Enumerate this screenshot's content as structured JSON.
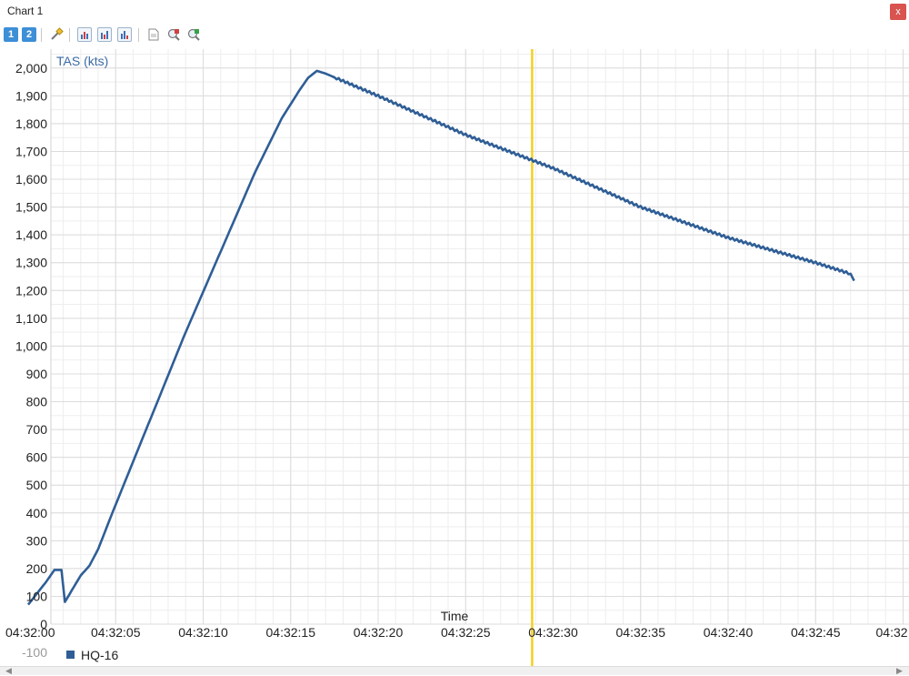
{
  "window": {
    "title": "Chart 1",
    "close_label": "x"
  },
  "toolbar": {
    "btn1_label": "1",
    "btn2_label": "2",
    "icons": [
      "marker-icon",
      "chart-type-a-icon",
      "chart-type-b-icon",
      "chart-type-c-icon",
      "page-icon",
      "zoom-in-icon",
      "zoom-out-icon"
    ]
  },
  "colors": {
    "series": "#2f5e96",
    "cursor": "#f5d020",
    "close": "#d9534f",
    "grid": "#e4e4e4"
  },
  "chart_data": {
    "type": "line",
    "ylabel": "TAS (kts)",
    "xlabel": "Time",
    "ylim": [
      -100,
      2050
    ],
    "xlim": [
      0,
      49
    ],
    "yticks": [
      -100,
      0,
      100,
      200,
      300,
      400,
      500,
      600,
      700,
      800,
      900,
      1000,
      1100,
      1200,
      1300,
      1400,
      1500,
      1600,
      1700,
      1800,
      1900,
      2000
    ],
    "ytick_labels": [
      "-100",
      "0",
      "100",
      "200",
      "300",
      "400",
      "500",
      "600",
      "700",
      "800",
      "900",
      "1,000",
      "1,100",
      "1,200",
      "1,300",
      "1,400",
      "1,500",
      "1,600",
      "1,700",
      "1,800",
      "1,900",
      "2,000"
    ],
    "xticks": [
      0,
      5,
      10,
      15,
      20,
      25,
      30,
      35,
      40,
      45,
      50
    ],
    "xtick_labels": [
      "04:32:00",
      "04:32:05",
      "04:32:10",
      "04:32:15",
      "04:32:20",
      "04:32:25",
      "04:32:30",
      "04:32:35",
      "04:32:40",
      "04:32:45",
      "04:32"
    ],
    "cursor_x": 28.8,
    "grid": true,
    "legend_position": "bottom-left",
    "series": [
      {
        "name": "HQ-16",
        "x": [
          0,
          0.5,
          1,
          1.5,
          1.9,
          2.1,
          3,
          3.5,
          4,
          5,
          7,
          9,
          11,
          13,
          14.5,
          15.5,
          16,
          16.5,
          17,
          20,
          25,
          30,
          35,
          40,
          45,
          46.5,
          47,
          47.2
        ],
        "y": [
          70,
          110,
          150,
          195,
          195,
          80,
          175,
          210,
          270,
          430,
          740,
          1050,
          1340,
          1630,
          1820,
          1920,
          1965,
          1990,
          1980,
          1900,
          1760,
          1640,
          1500,
          1390,
          1300,
          1270,
          1260,
          1235
        ]
      }
    ]
  }
}
